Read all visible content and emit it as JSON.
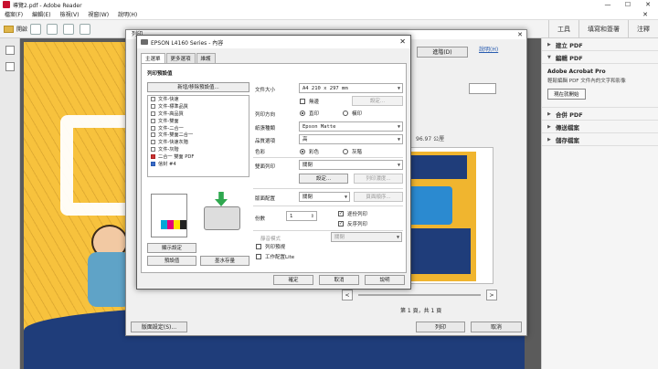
{
  "window": {
    "title": "導覽2.pdf - Adobe Reader",
    "controls": [
      "—",
      "☐",
      "✕"
    ]
  },
  "menu": {
    "items": [
      "檔案(F)",
      "編輯(E)",
      "檢視(V)",
      "視窗(W)",
      "說明(H)"
    ],
    "close": "✕"
  },
  "toolbar": {
    "open_label": "開啟",
    "right_tabs": [
      "工具",
      "填寫和簽署",
      "注釋"
    ]
  },
  "right_pane": {
    "sections_top": [
      {
        "label": "建立 PDF",
        "arrow": "▶"
      },
      {
        "label": "編輯 PDF",
        "arrow": "▼"
      }
    ],
    "promo": {
      "title": "Adobe Acrobat Pro",
      "desc": "輕鬆編輯 PDF 文件內的文字和影像",
      "button": "現在就開始"
    },
    "sections_bottom": [
      {
        "label": "合併 PDF",
        "arrow": "▶"
      },
      {
        "label": "傳送檔案",
        "arrow": "▶"
      },
      {
        "label": "儲存檔案",
        "arrow": "▶"
      }
    ]
  },
  "print_dialog": {
    "title": "列印",
    "close": "✕",
    "help": "說明(H)",
    "advanced_label": "進階(D)",
    "size_label": "96.97 公厘",
    "zoom_prev": "<",
    "zoom_next": ">",
    "pages": "第 1 頁，共 1 頁",
    "page_setup": "版面設定(S)...",
    "print": "列印",
    "cancel": "取消"
  },
  "epson": {
    "title": "EPSON L4160 Series - 內容",
    "close": "✕",
    "tabs": [
      "主選單",
      "更多選項",
      "維護"
    ],
    "presets_heading": "列印預設值",
    "add_remove_button": "新增/移除預設值...",
    "presets": [
      {
        "label": "文件-快速",
        "icon": "doc"
      },
      {
        "label": "文件-標準品質",
        "icon": "doc"
      },
      {
        "label": "文件-高品質",
        "icon": "doc"
      },
      {
        "label": "文件-雙面",
        "icon": "doc"
      },
      {
        "label": "文件-二合一",
        "icon": "doc"
      },
      {
        "label": "文件-雙面二合一",
        "icon": "doc"
      },
      {
        "label": "文件-快速灰階",
        "icon": "doc"
      },
      {
        "label": "文件-灰階",
        "icon": "doc"
      },
      {
        "label": "二合一 雙面 PDF",
        "icon": "pdf"
      },
      {
        "label": "信封 #4",
        "icon": "blue"
      }
    ],
    "show_settings_button": "顯示設定",
    "defaults_button": "預設值",
    "ink_levels_button": "墨水存量",
    "paper_size_label": "文件大小",
    "paper_size_value": "A4 210 x 297 mm",
    "borderless_label": "無邊",
    "borderless_settings_button": "設定...",
    "orientation_label": "列印方向",
    "portrait_label": "直印",
    "landscape_label": "橫印",
    "paper_type_label": "紙張種類",
    "paper_type_value": "Epson Matte",
    "quality_label": "品質選項",
    "quality_value": "高",
    "color_label": "色彩",
    "color_option": "彩色",
    "grayscale_option": "灰階",
    "duplex_label": "雙面列印",
    "duplex_value": "關閉",
    "duplex_settings_button": "設定...",
    "print_density_button": "列印濃度...",
    "multipage_label": "版面配置",
    "multipage_value": "關閉",
    "page_order_button": "頁面順序...",
    "copies_label": "份數",
    "copies_value": "1",
    "collate_label": "逐份列印",
    "reverse_label": "反序列印",
    "quiet_mode_label": "靜音模式",
    "quiet_mode_value": "關閉",
    "print_preview_label": "列印預視",
    "job_arranger_label": "工作配置Lite",
    "ok_button": "確定",
    "cancel_button": "取消",
    "help_button": "說明"
  }
}
